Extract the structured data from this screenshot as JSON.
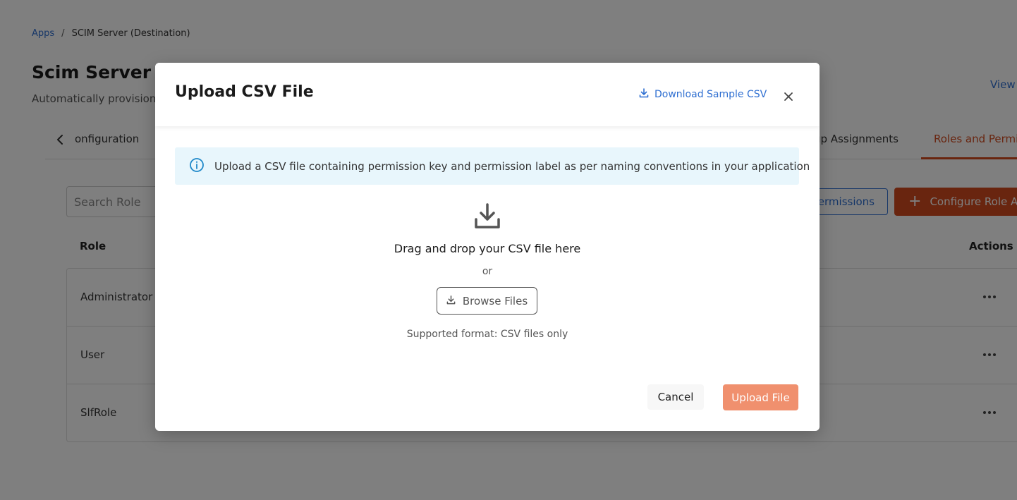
{
  "breadcrumb": {
    "link": "Apps",
    "separator": "/",
    "current": "SCIM Server (Destination)"
  },
  "page": {
    "title": "Scim Server A",
    "subtitle": "Automatically provision",
    "view_link": "View"
  },
  "tabs": {
    "items": [
      {
        "label": "onfiguration"
      },
      {
        "label": "up Assignments"
      },
      {
        "label": "Roles and Permi"
      }
    ],
    "active_index": 2
  },
  "toolbar": {
    "search_placeholder": "Search Role",
    "permissions_label": "ermissions",
    "configure_label": "Configure Role A"
  },
  "table": {
    "columns": {
      "role": "Role",
      "actions": "Actions"
    },
    "rows": [
      {
        "role": "Administrator"
      },
      {
        "role": "User"
      },
      {
        "role": "SlfRole"
      }
    ]
  },
  "modal": {
    "title": "Upload CSV File",
    "download_sample_label": "Download Sample CSV",
    "info_text": "Upload a CSV file containing permission key and permission label as per naming conventions in your application",
    "drop_title": "Drag and drop your CSV file here",
    "or_text": "or",
    "browse_label": "Browse Files",
    "supported_text": "Supported format: CSV files only",
    "cancel_label": "Cancel",
    "upload_label": "Upload File"
  },
  "colors": {
    "accent": "#d24a1e",
    "link": "#2f6fd1",
    "upload_disabled": "#f0906e",
    "info_bg": "#e8f6fc",
    "info_icon": "#1e88c9"
  },
  "icons": {
    "back": "chevron-left-icon",
    "download_sample": "download-icon",
    "close": "close-icon",
    "info": "info-icon",
    "drop": "download-tray-icon",
    "browse": "download-icon",
    "more": "more-horizontal-icon",
    "plus": "plus-icon"
  }
}
